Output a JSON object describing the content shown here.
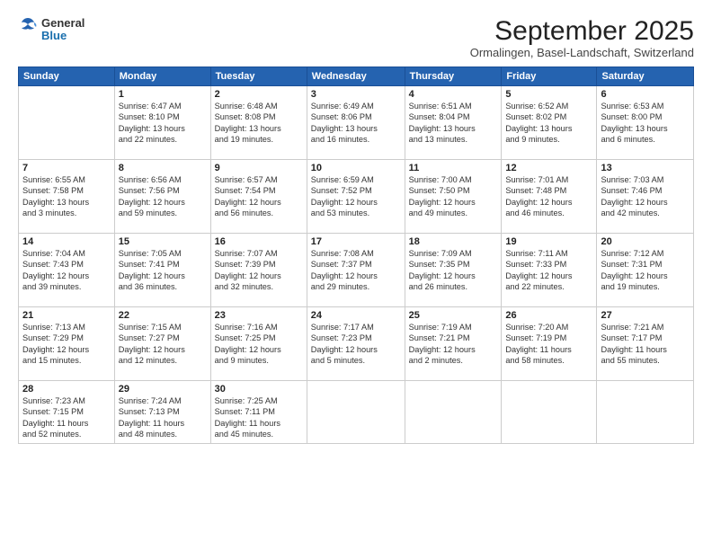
{
  "header": {
    "logo_general": "General",
    "logo_blue": "Blue",
    "month_title": "September 2025",
    "location": "Ormalingen, Basel-Landschaft, Switzerland"
  },
  "days_of_week": [
    "Sunday",
    "Monday",
    "Tuesday",
    "Wednesday",
    "Thursday",
    "Friday",
    "Saturday"
  ],
  "weeks": [
    [
      {
        "day": "",
        "text": ""
      },
      {
        "day": "1",
        "text": "Sunrise: 6:47 AM\nSunset: 8:10 PM\nDaylight: 13 hours\nand 22 minutes."
      },
      {
        "day": "2",
        "text": "Sunrise: 6:48 AM\nSunset: 8:08 PM\nDaylight: 13 hours\nand 19 minutes."
      },
      {
        "day": "3",
        "text": "Sunrise: 6:49 AM\nSunset: 8:06 PM\nDaylight: 13 hours\nand 16 minutes."
      },
      {
        "day": "4",
        "text": "Sunrise: 6:51 AM\nSunset: 8:04 PM\nDaylight: 13 hours\nand 13 minutes."
      },
      {
        "day": "5",
        "text": "Sunrise: 6:52 AM\nSunset: 8:02 PM\nDaylight: 13 hours\nand 9 minutes."
      },
      {
        "day": "6",
        "text": "Sunrise: 6:53 AM\nSunset: 8:00 PM\nDaylight: 13 hours\nand 6 minutes."
      }
    ],
    [
      {
        "day": "7",
        "text": "Sunrise: 6:55 AM\nSunset: 7:58 PM\nDaylight: 13 hours\nand 3 minutes."
      },
      {
        "day": "8",
        "text": "Sunrise: 6:56 AM\nSunset: 7:56 PM\nDaylight: 12 hours\nand 59 minutes."
      },
      {
        "day": "9",
        "text": "Sunrise: 6:57 AM\nSunset: 7:54 PM\nDaylight: 12 hours\nand 56 minutes."
      },
      {
        "day": "10",
        "text": "Sunrise: 6:59 AM\nSunset: 7:52 PM\nDaylight: 12 hours\nand 53 minutes."
      },
      {
        "day": "11",
        "text": "Sunrise: 7:00 AM\nSunset: 7:50 PM\nDaylight: 12 hours\nand 49 minutes."
      },
      {
        "day": "12",
        "text": "Sunrise: 7:01 AM\nSunset: 7:48 PM\nDaylight: 12 hours\nand 46 minutes."
      },
      {
        "day": "13",
        "text": "Sunrise: 7:03 AM\nSunset: 7:46 PM\nDaylight: 12 hours\nand 42 minutes."
      }
    ],
    [
      {
        "day": "14",
        "text": "Sunrise: 7:04 AM\nSunset: 7:43 PM\nDaylight: 12 hours\nand 39 minutes."
      },
      {
        "day": "15",
        "text": "Sunrise: 7:05 AM\nSunset: 7:41 PM\nDaylight: 12 hours\nand 36 minutes."
      },
      {
        "day": "16",
        "text": "Sunrise: 7:07 AM\nSunset: 7:39 PM\nDaylight: 12 hours\nand 32 minutes."
      },
      {
        "day": "17",
        "text": "Sunrise: 7:08 AM\nSunset: 7:37 PM\nDaylight: 12 hours\nand 29 minutes."
      },
      {
        "day": "18",
        "text": "Sunrise: 7:09 AM\nSunset: 7:35 PM\nDaylight: 12 hours\nand 26 minutes."
      },
      {
        "day": "19",
        "text": "Sunrise: 7:11 AM\nSunset: 7:33 PM\nDaylight: 12 hours\nand 22 minutes."
      },
      {
        "day": "20",
        "text": "Sunrise: 7:12 AM\nSunset: 7:31 PM\nDaylight: 12 hours\nand 19 minutes."
      }
    ],
    [
      {
        "day": "21",
        "text": "Sunrise: 7:13 AM\nSunset: 7:29 PM\nDaylight: 12 hours\nand 15 minutes."
      },
      {
        "day": "22",
        "text": "Sunrise: 7:15 AM\nSunset: 7:27 PM\nDaylight: 12 hours\nand 12 minutes."
      },
      {
        "day": "23",
        "text": "Sunrise: 7:16 AM\nSunset: 7:25 PM\nDaylight: 12 hours\nand 9 minutes."
      },
      {
        "day": "24",
        "text": "Sunrise: 7:17 AM\nSunset: 7:23 PM\nDaylight: 12 hours\nand 5 minutes."
      },
      {
        "day": "25",
        "text": "Sunrise: 7:19 AM\nSunset: 7:21 PM\nDaylight: 12 hours\nand 2 minutes."
      },
      {
        "day": "26",
        "text": "Sunrise: 7:20 AM\nSunset: 7:19 PM\nDaylight: 11 hours\nand 58 minutes."
      },
      {
        "day": "27",
        "text": "Sunrise: 7:21 AM\nSunset: 7:17 PM\nDaylight: 11 hours\nand 55 minutes."
      }
    ],
    [
      {
        "day": "28",
        "text": "Sunrise: 7:23 AM\nSunset: 7:15 PM\nDaylight: 11 hours\nand 52 minutes."
      },
      {
        "day": "29",
        "text": "Sunrise: 7:24 AM\nSunset: 7:13 PM\nDaylight: 11 hours\nand 48 minutes."
      },
      {
        "day": "30",
        "text": "Sunrise: 7:25 AM\nSunset: 7:11 PM\nDaylight: 11 hours\nand 45 minutes."
      },
      {
        "day": "",
        "text": ""
      },
      {
        "day": "",
        "text": ""
      },
      {
        "day": "",
        "text": ""
      },
      {
        "day": "",
        "text": ""
      }
    ]
  ]
}
